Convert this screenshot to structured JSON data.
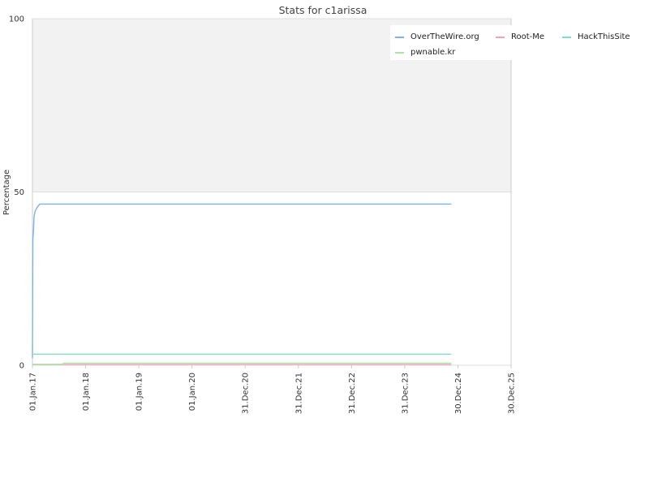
{
  "chart_data": {
    "type": "line",
    "title": "Stats for c1arissa",
    "xlabel": "",
    "ylabel": "Percentage",
    "x_ticks": [
      "01.Jan.17",
      "01.Jan.18",
      "01.Jan.19",
      "01.Jan.20",
      "31.Dec.20",
      "31.Dec.21",
      "31.Dec.22",
      "31.Dec.23",
      "30.Dec.24",
      "30.Dec.25"
    ],
    "x_range": [
      "01.Jan.17",
      "30.Dec.25"
    ],
    "y_ticks": [
      0,
      50,
      100
    ],
    "ylim": [
      0,
      100
    ],
    "grid": true,
    "legend_position": "top-right",
    "colors": {
      "plot_upper_band": "#f2f2f2",
      "grid": "#dddddd",
      "axis": "#cccccc"
    },
    "series": [
      {
        "name": "OverTheWire.org",
        "color": "#7fb0e8",
        "points": [
          [
            "2017-01-01",
            2
          ],
          [
            "2017-01-04",
            36
          ],
          [
            "2017-01-08",
            39
          ],
          [
            "2017-01-12",
            43
          ],
          [
            "2017-01-20",
            44.5
          ],
          [
            "2017-02-01",
            45.5
          ],
          [
            "2017-02-20",
            46.5
          ],
          [
            "2024-11-15",
            46.5
          ]
        ]
      },
      {
        "name": "Root-Me",
        "color": "#f4a0c0",
        "points": [
          [
            "2017-01-01",
            0.2
          ],
          [
            "2024-11-15",
            0.2
          ]
        ]
      },
      {
        "name": "HackThisSite",
        "color": "#7fe0c0",
        "points": [
          [
            "2017-01-01",
            3.2
          ],
          [
            "2024-11-15",
            3.2
          ]
        ]
      },
      {
        "name": "pwnable.kr",
        "color": "#a8e8a0",
        "points": [
          [
            "2017-01-01",
            0.3
          ],
          [
            "2017-08-01",
            0.3
          ],
          [
            "2017-08-02",
            0.6
          ],
          [
            "2024-11-15",
            0.6
          ]
        ]
      }
    ]
  }
}
